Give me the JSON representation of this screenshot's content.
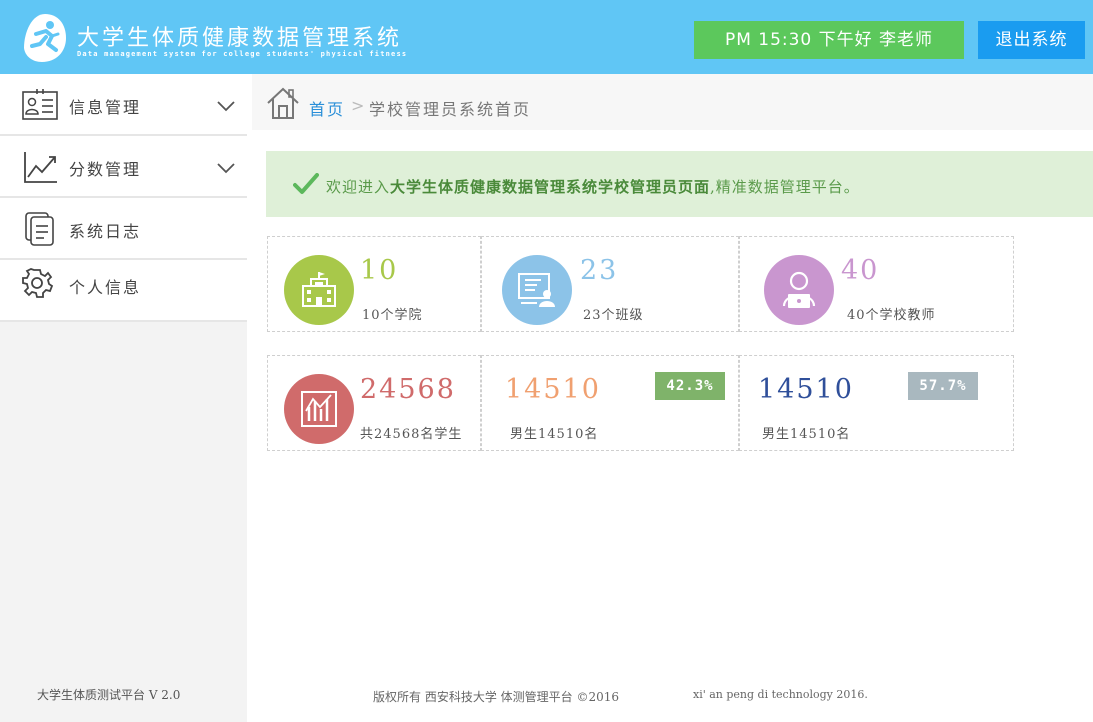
{
  "header": {
    "title": "大学生体质健康数据管理系统",
    "subtitle": "Data management system for college students' physical fitness",
    "greeting": "PM 15:30 下午好 李老师",
    "logout_label": "退出系统"
  },
  "sidebar": {
    "items": [
      {
        "label": "信息管理",
        "icon": "id-card-icon",
        "expandable": true
      },
      {
        "label": "分数管理",
        "icon": "line-chart-icon",
        "expandable": true
      },
      {
        "label": "系统日志",
        "icon": "document-icon",
        "expandable": false
      },
      {
        "label": "个人信息",
        "icon": "gear-icon",
        "expandable": false
      }
    ],
    "version": "大学生体质测试平台 V 2.0"
  },
  "breadcrumb": {
    "home": "首页",
    "separator": ">",
    "current": "学校管理员系统首页"
  },
  "welcome": {
    "prefix": "欢迎进入",
    "highlight": "大学生体质健康数据管理系统学校管理员页面",
    "suffix": ",精准数据管理平台。"
  },
  "stats": {
    "colleges": {
      "value": "10",
      "caption": "10个学院",
      "color": "#a8c84a",
      "icon": "school-building-icon"
    },
    "classes": {
      "value": "23",
      "caption": "23个班级",
      "color": "#8cc3e8",
      "icon": "classroom-icon"
    },
    "teachers": {
      "value": "40",
      "caption": "40个学校教师",
      "color": "#c996cf",
      "icon": "teacher-icon"
    },
    "students": {
      "value": "24568",
      "caption": "共24568名学生",
      "color": "#d06b6b",
      "icon": "bar-chart-icon"
    },
    "male": {
      "value": "14510",
      "caption": "男生14510名",
      "percent": "42.3%",
      "color": "#f0a070",
      "badge_color": "#7fb36a"
    },
    "female": {
      "value": "14510",
      "caption": "男生14510名",
      "percent": "57.7%",
      "color": "#2f4f9a",
      "badge_color": "#a9b8bf"
    }
  },
  "footer": {
    "copyright": "版权所有 西安科技大学  体测管理平台 ©2016",
    "english": "xi' an peng di technology 2016."
  }
}
